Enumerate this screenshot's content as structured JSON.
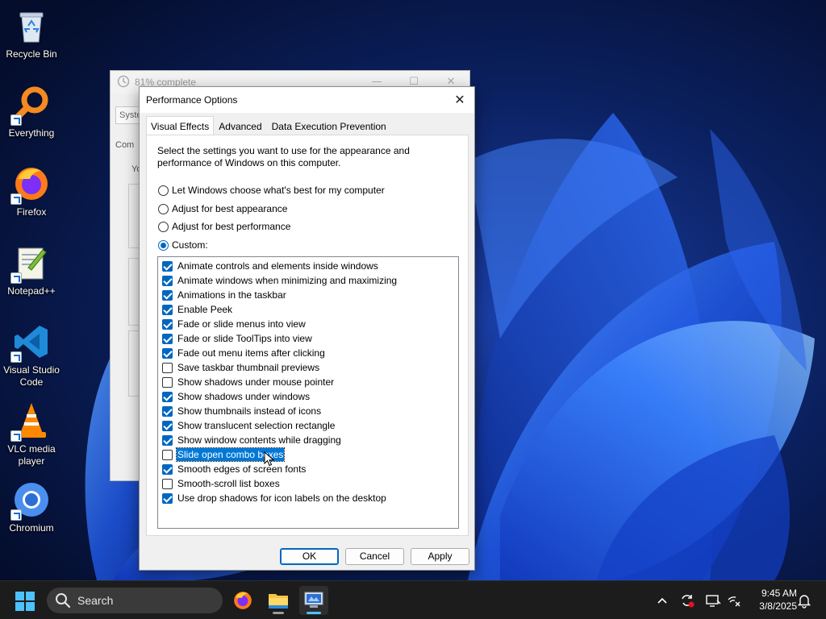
{
  "desktop": {
    "icons": [
      {
        "label": "Recycle Bin",
        "icon": "recycle-bin-icon"
      },
      {
        "label": "Everything",
        "icon": "everything-search-icon"
      },
      {
        "label": "Firefox",
        "icon": "firefox-icon"
      },
      {
        "label": "Notepad++",
        "icon": "notepad-plus-plus-icon"
      },
      {
        "label": "Visual Studio Code",
        "icon": "vscode-icon"
      },
      {
        "label": "VLC media player",
        "icon": "vlc-icon"
      },
      {
        "label": "Chromium",
        "icon": "chromium-icon"
      }
    ]
  },
  "background_window": {
    "title": "81% complete",
    "tab_fragment": "Syste",
    "label_fragment": "Com",
    "text_fragment": "Yo"
  },
  "dialog": {
    "title": "Performance Options",
    "close_glyph": "✕",
    "tabs": [
      {
        "label": "Visual Effects",
        "active": true
      },
      {
        "label": "Advanced",
        "active": false
      },
      {
        "label": "Data Execution Prevention",
        "active": false
      }
    ],
    "description": "Select the settings you want to use for the appearance and performance of Windows on this computer.",
    "radios": [
      {
        "label": "Let Windows choose what's best for my computer",
        "checked": false
      },
      {
        "label": "Adjust for best appearance",
        "checked": false
      },
      {
        "label": "Adjust for best performance",
        "checked": false
      },
      {
        "label": "Custom:",
        "checked": true
      }
    ],
    "effects": [
      {
        "label": "Animate controls and elements inside windows",
        "checked": true
      },
      {
        "label": "Animate windows when minimizing and maximizing",
        "checked": true
      },
      {
        "label": "Animations in the taskbar",
        "checked": true
      },
      {
        "label": "Enable Peek",
        "checked": true
      },
      {
        "label": "Fade or slide menus into view",
        "checked": true
      },
      {
        "label": "Fade or slide ToolTips into view",
        "checked": true
      },
      {
        "label": "Fade out menu items after clicking",
        "checked": true
      },
      {
        "label": "Save taskbar thumbnail previews",
        "checked": false
      },
      {
        "label": "Show shadows under mouse pointer",
        "checked": false
      },
      {
        "label": "Show shadows under windows",
        "checked": true
      },
      {
        "label": "Show thumbnails instead of icons",
        "checked": true
      },
      {
        "label": "Show translucent selection rectangle",
        "checked": true
      },
      {
        "label": "Show window contents while dragging",
        "checked": true
      },
      {
        "label": "Slide open combo boxes",
        "checked": false,
        "selected": true
      },
      {
        "label": "Smooth edges of screen fonts",
        "checked": true
      },
      {
        "label": "Smooth-scroll list boxes",
        "checked": false
      },
      {
        "label": "Use drop shadows for icon labels on the desktop",
        "checked": true
      }
    ],
    "buttons": {
      "ok": "OK",
      "cancel": "Cancel",
      "apply": "Apply"
    }
  },
  "taskbar": {
    "search_label": "Search",
    "pinned": [
      {
        "icon": "firefox-icon",
        "active": false
      },
      {
        "icon": "file-explorer-icon",
        "active": false
      },
      {
        "icon": "system-properties-icon",
        "active": true
      }
    ],
    "tray": [
      "chevron-up-icon",
      "sync-icon",
      "display-icon",
      "network-icon",
      "notifications-icon"
    ],
    "time": "9:45 AM",
    "date": "3/8/2025"
  },
  "colors": {
    "accent": "#0067c0",
    "selection": "#0078d7",
    "taskbar": "#1c1c1c",
    "wallpaper_dark": "#06123a"
  }
}
